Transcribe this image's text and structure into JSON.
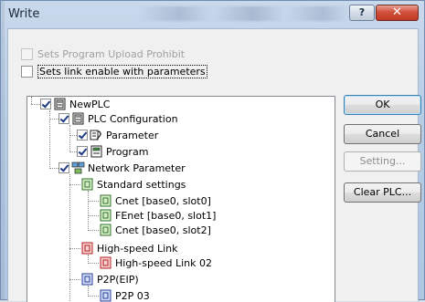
{
  "window": {
    "title": "Write"
  },
  "titlebar": {
    "help_label": "?",
    "close_label": "✕"
  },
  "options": {
    "upload_prohibit": {
      "label": "Sets Program Upload Prohibit",
      "checked": false,
      "enabled": false
    },
    "link_enable": {
      "label": "Sets link enable with parameters",
      "checked": false,
      "enabled": true
    }
  },
  "tree": {
    "nodes": [
      {
        "label": "NewPLC",
        "checked": true,
        "icon": "plc-icon"
      },
      {
        "label": "PLC Configuration",
        "checked": true,
        "icon": "plc-icon"
      },
      {
        "label": "Parameter",
        "checked": true,
        "icon": "parameter-icon"
      },
      {
        "label": "Program",
        "checked": true,
        "icon": "program-icon"
      },
      {
        "label": "Network Parameter",
        "checked": true,
        "icon": "network-icon"
      },
      {
        "label": "Standard settings",
        "icon": "module-icon"
      },
      {
        "label": "Cnet [base0, slot0]",
        "icon": "module-icon"
      },
      {
        "label": "FEnet [base0, slot1]",
        "icon": "module-icon"
      },
      {
        "label": "Cnet [base0, slot2]",
        "icon": "module-icon"
      },
      {
        "label": "High-speed Link",
        "icon": "link-red-icon"
      },
      {
        "label": "High-speed Link 02",
        "icon": "link-red-icon"
      },
      {
        "label": "P2P(EIP)",
        "icon": "p2p-icon"
      },
      {
        "label": "P2P 03",
        "icon": "p2p-icon"
      }
    ]
  },
  "buttons": {
    "ok": "OK",
    "cancel": "Cancel",
    "setting": "Setting...",
    "clear_plc": "Clear PLC..."
  },
  "colors": {
    "checkmark": "#1f3b85",
    "close_red": "#c03a24",
    "accent_blue": "#3c7fb1"
  }
}
